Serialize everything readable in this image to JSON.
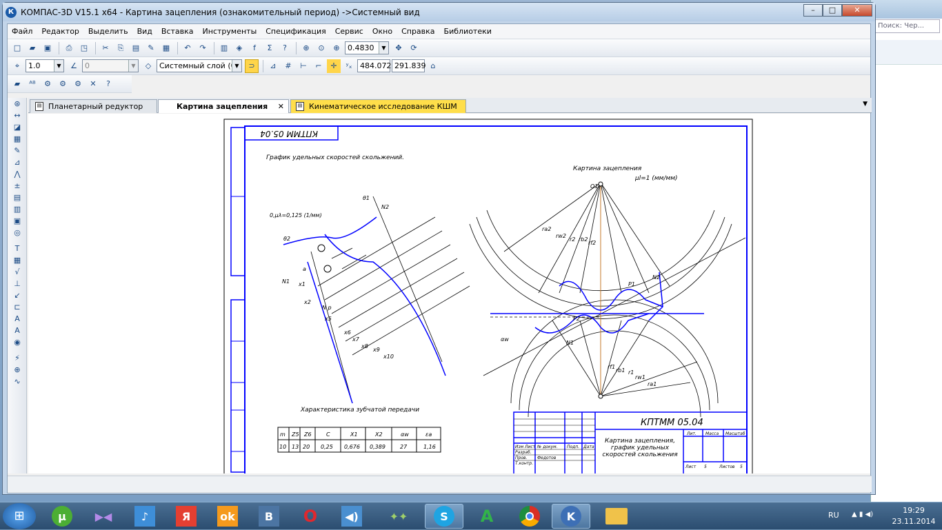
{
  "window": {
    "title": "КОМПАС-3D V15.1 x64 - Картина зацепления (ознакомительный период) ->Системный вид",
    "app_icon": "К"
  },
  "background_window": {
    "search_placeholder": "Поиск: Чер..."
  },
  "menu": [
    "Файл",
    "Редактор",
    "Выделить",
    "Вид",
    "Вставка",
    "Инструменты",
    "Спецификация",
    "Сервис",
    "Окно",
    "Справка",
    "Библиотеки"
  ],
  "toolbar": {
    "zoom_value": "0.4830",
    "line_step": "1.0",
    "angle_step": "0",
    "layer": "Системный слой (0)",
    "coord_x": "484.072",
    "coord_y": "291.839"
  },
  "tabs": [
    {
      "label": "Планетарный редуктор",
      "active": false
    },
    {
      "label": "Картина зацепления",
      "active": true
    },
    {
      "label": "Кинематическое исследование КШМ",
      "active": false
    }
  ],
  "drawing": {
    "stamp_code_top": "КПТММ 05.04",
    "graph_title": "График удельных скоростей скольжений.",
    "scale_label": "0,μλ=0,125 (1/мм)",
    "mesh_title": "Картина зацепления",
    "mesh_scale": "μl=1 (мм/мм)",
    "table_title": "Характеристика зубчатой передачи",
    "table_headers": [
      "m",
      "Z5",
      "Z6",
      "C",
      "X1",
      "X2",
      "αw",
      "εa"
    ],
    "table_values": [
      "10",
      "13",
      "20",
      "0,25",
      "0,676",
      "0,389",
      "27",
      "1,16"
    ],
    "stamp_code": "КПТММ 05.04",
    "stamp_name": "Картина зацепления, график удельных скоростей скольжения",
    "stamp_labels": [
      "Изм",
      "Лист",
      "№ докум.",
      "Подп.",
      "Дата",
      "Разраб.",
      "Пров.",
      "Т.контр.",
      "Лит.",
      "Масса",
      "Масштаб",
      "Лист",
      "Листов"
    ],
    "stamp_author": "Федотов",
    "stamp_sheet": "5",
    "stamp_sheets": "5",
    "labels_mesh": [
      "ra2",
      "rw2",
      "r2",
      "rb2",
      "rf2",
      "ra1",
      "rw1",
      "r1",
      "rb1",
      "rf1",
      "αw",
      "O1",
      "N1",
      "N2",
      "P1",
      "P2"
    ],
    "labels_graph": [
      "θ1",
      "θ2",
      "N1",
      "N2",
      "x1",
      "x2",
      "x5",
      "x6",
      "x7",
      "x8",
      "x9",
      "x10",
      "a",
      "N p"
    ]
  },
  "taskbar": {
    "lang": "RU",
    "time": "19:29",
    "date": "23.11.2014"
  },
  "colors": {
    "accent_blue": "#0000ff",
    "tab_active_yellow": "#ffde4a",
    "taskbar": "#2b4d70"
  }
}
